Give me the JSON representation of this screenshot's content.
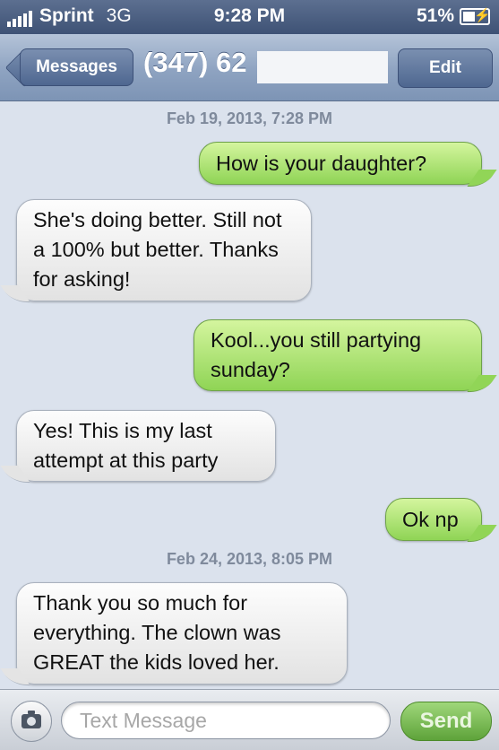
{
  "status": {
    "carrier": "Sprint",
    "network": "3G",
    "time": "9:28 PM",
    "battery": "51%"
  },
  "nav": {
    "back_label": "Messages",
    "title": "(347) 62",
    "edit_label": "Edit"
  },
  "conversation": {
    "timestamp_1": "Feb 19, 2013, 7:28 PM",
    "msg_1": "How is your daughter?",
    "msg_2": "She's doing better. Still not a 100% but better. Thanks for asking!",
    "msg_3": "Kool...you still partying sunday?",
    "msg_4": "Yes! This is my last attempt at this party",
    "msg_5": "Ok np",
    "timestamp_2": "Feb 24, 2013, 8:05 PM",
    "msg_6": "Thank you so much for everything. The clown was GREAT the kids loved her."
  },
  "composer": {
    "placeholder": "Text Message",
    "value": "",
    "send_label": "Send"
  },
  "colors": {
    "outgoing_bubble": "#8fd455",
    "incoming_bubble": "#f2f2f2",
    "nav_bar": "#8ea3c1",
    "background": "#dbe2ed"
  },
  "icons": {
    "camera": "camera-icon",
    "back": "chevron-left-icon",
    "battery": "battery-icon",
    "signal": "signal-bars-icon"
  }
}
